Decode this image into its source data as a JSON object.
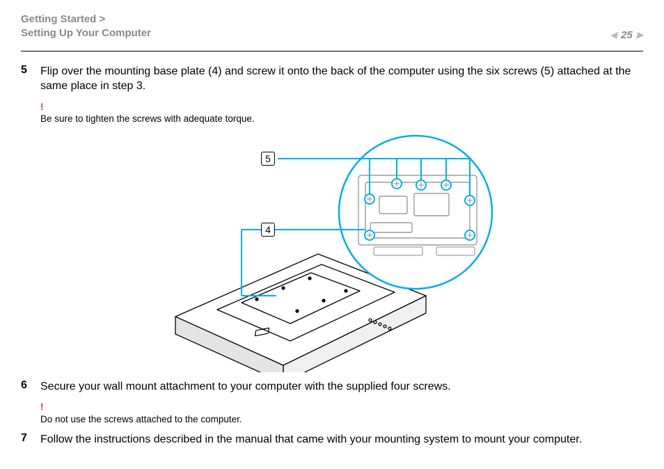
{
  "header": {
    "breadcrumb_line1": "Getting Started >",
    "breadcrumb_line2": "Setting Up Your Computer",
    "page_number": "25"
  },
  "steps": {
    "s5": {
      "num": "5",
      "text": "Flip over the mounting base plate (4) and screw it onto the back of the computer using the six screws (5) attached at the same place in step 3.",
      "note_bang": "!",
      "note_text": "Be sure to tighten the screws with adequate torque."
    },
    "s6": {
      "num": "6",
      "text": "Secure your wall mount attachment to your computer with the supplied four screws.",
      "note_bang": "!",
      "note_text": "Do not use the screws attached to the computer."
    },
    "s7": {
      "num": "7",
      "text": "Follow the instructions described in the manual that came with your mounting system to mount your computer."
    }
  },
  "figure": {
    "callout5": "5",
    "callout4": "4"
  }
}
